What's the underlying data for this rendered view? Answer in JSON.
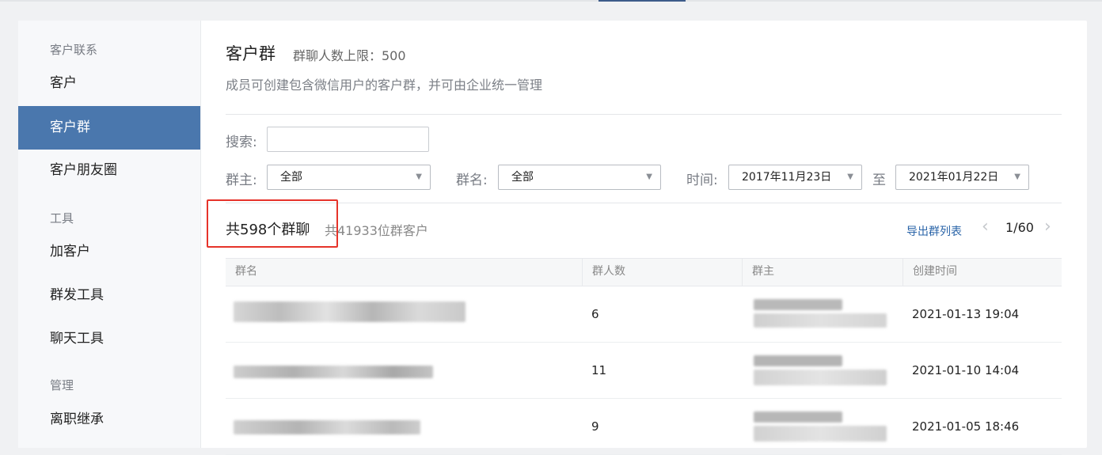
{
  "sidebar": {
    "sections": [
      {
        "title": "客户联系",
        "items": [
          "客户",
          "客户群",
          "客户朋友圈"
        ]
      },
      {
        "title": "工具",
        "items": [
          "加客户",
          "群发工具",
          "聊天工具"
        ]
      },
      {
        "title": "管理",
        "items": [
          "离职继承"
        ]
      }
    ],
    "active_item": "客户群"
  },
  "header": {
    "title": "客户群",
    "limit_text": "群聊人数上限：500",
    "description": "成员可创建包含微信用户的客户群，并可由企业统一管理"
  },
  "filters": {
    "search_label": "搜索:",
    "search_value": "",
    "owner_label": "群主:",
    "owner_value": "全部",
    "name_label": "群名:",
    "name_value": "全部",
    "time_label": "时间:",
    "time_from": "2017年11月23日",
    "time_to_label": "至",
    "time_to": "2021年01月22日"
  },
  "summary": {
    "group_count": "共598个群聊",
    "customer_count": "共41933位群客户",
    "export_label": "导出群列表",
    "page": "1/60"
  },
  "table": {
    "columns": [
      "群名",
      "群人数",
      "群主",
      "创建时间"
    ],
    "rows": [
      {
        "name": "",
        "members": "6",
        "owner": "",
        "created": "2021-01-13 19:04"
      },
      {
        "name": "",
        "members": "11",
        "owner": "",
        "created": "2021-01-10 14:04"
      },
      {
        "name": "",
        "members": "9",
        "owner": "",
        "created": "2021-01-05 18:46"
      }
    ]
  },
  "colors": {
    "accent": "#4a77ad",
    "link": "#2a64a8",
    "highlight_box": "#e6332a"
  },
  "icons": {
    "dropdown": "caret-down-icon",
    "prev": "chevron-left-icon",
    "next": "chevron-right-icon"
  }
}
